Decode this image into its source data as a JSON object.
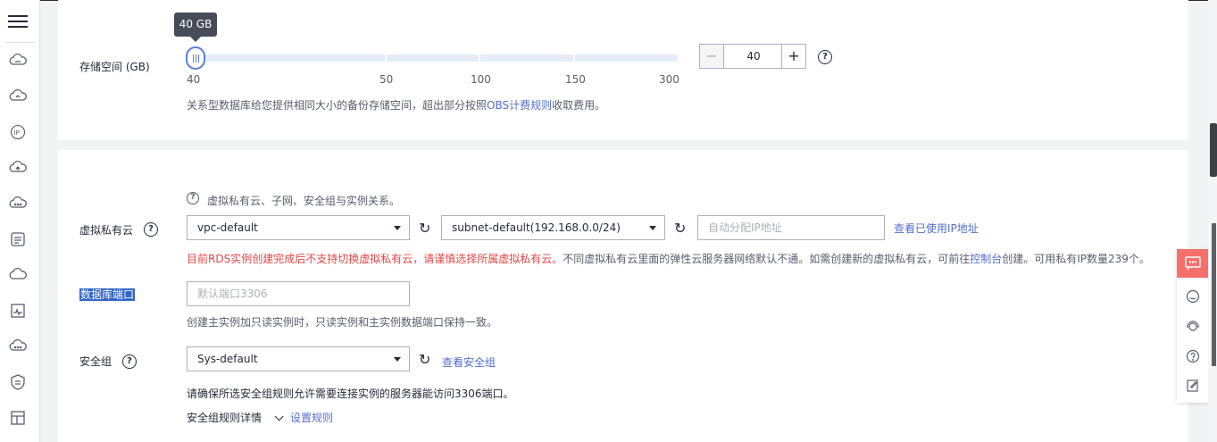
{
  "sidebar": {
    "icons": [
      "menu-icon",
      "rds-icon",
      "cloud-icon",
      "ip-icon",
      "cloud-upload-icon",
      "cloud-more-icon",
      "list-icon",
      "cloud-icon-2",
      "pulse-icon",
      "cloud-more-icon-2",
      "shield-icon",
      "layout-icon"
    ]
  },
  "storage": {
    "label": "存储空间 (GB)",
    "tooltip": "40 GB",
    "ticks": [
      "40",
      "50",
      "100",
      "150",
      "300"
    ],
    "value": "40",
    "hint_prefix": "关系型数据库给您提供相同大小的备份存储空间，超出部分按照",
    "hint_link": "OBS计费规则",
    "hint_suffix": "收取费用。"
  },
  "network": {
    "relation_hint": "虚拟私有云、子网、安全组与实例关系。",
    "vpc_label": "虚拟私有云",
    "vpc_value": "vpc-default",
    "subnet_value": "subnet-default(192.168.0.0/24)",
    "ip_placeholder": "自动分配IP地址",
    "view_ip_link": "查看已使用IP地址",
    "warn_red": "目前RDS实例创建完成后不支持切换虚拟私有云，请谨慎选择所属虚拟私有云。",
    "warn_rest_1": "不同虚拟私有云里面的弹性云服务器网络默认不通。如需创建新的虚拟私有云，可前往",
    "warn_link": "控制台",
    "warn_rest_2": "创建。可用私有IP数量239个。",
    "port_label": "数据库端口",
    "port_placeholder": "默认端口3306",
    "port_hint": "创建主实例加只读实例时，只读实例和主实例数据端口保持一致。",
    "sg_label": "安全组",
    "sg_value": "Sys-default",
    "sg_link": "查看安全组",
    "sg_hint": "请确保所选安全组规则允许需要连接实例的服务器能访问3306端口。",
    "sg_details": "安全组规则详情",
    "sg_set_rule": "设置规则"
  },
  "colors": {
    "accent": "#5e7ce0",
    "link": "#526ecc",
    "warn": "#e54545",
    "feedback": "#f66f6a"
  }
}
